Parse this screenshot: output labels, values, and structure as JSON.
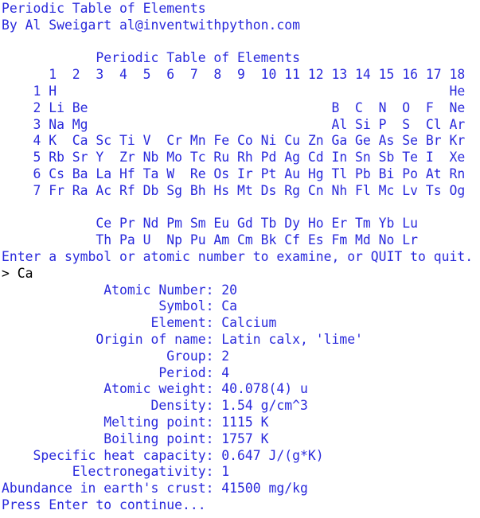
{
  "colors": {
    "output_text": "#2a2adc",
    "input_text": "#000000",
    "background": "#ffffff"
  },
  "header": {
    "title": "Periodic Table of Elements",
    "author": "By Al Sweigart al@inventwithpython.com"
  },
  "table": {
    "title": "            Periodic Table of Elements",
    "columns": "      1  2  3  4  5  6  7  8  9  10 11 12 13 14 15 16 17 18",
    "rows": [
      "    1 H                                                  He",
      "    2 Li Be                               B  C  N  O  F  Ne",
      "    3 Na Mg                               Al Si P  S  Cl Ar",
      "    4 K  Ca Sc Ti V  Cr Mn Fe Co Ni Cu Zn Ga Ge As Se Br Kr",
      "    5 Rb Sr Y  Zr Nb Mo Tc Ru Rh Pd Ag Cd In Sn Sb Te I  Xe",
      "    6 Cs Ba La Hf Ta W  Re Os Ir Pt Au Hg Tl Pb Bi Po At Rn",
      "    7 Fr Ra Ac Rf Db Sg Bh Hs Mt Ds Rg Cn Nh Fl Mc Lv Ts Og"
    ],
    "lanthanides": "            Ce Pr Nd Pm Sm Eu Gd Tb Dy Ho Er Tm Yb Lu",
    "actinides": "            Th Pa U  Np Pu Am Cm Bk Cf Es Fm Md No Lr"
  },
  "prompt": "Enter a symbol or atomic number to examine, or QUIT to quit.",
  "user_input": "> Ca",
  "details": [
    "             Atomic Number: 20",
    "                    Symbol: Ca",
    "                   Element: Calcium",
    "            Origin of name: Latin calx, 'lime'",
    "                     Group: 2",
    "                    Period: 4",
    "             Atomic weight: 40.078(4) u",
    "                   Density: 1.54 g/cm^3",
    "             Melting point: 1115 K",
    "             Boiling point: 1757 K",
    "    Specific heat capacity: 0.647 J/(g*K)",
    "         Electronegativity: 1",
    "Abundance in earth's crust: 41500 mg/kg"
  ],
  "continue_prompt": "Press Enter to continue..."
}
